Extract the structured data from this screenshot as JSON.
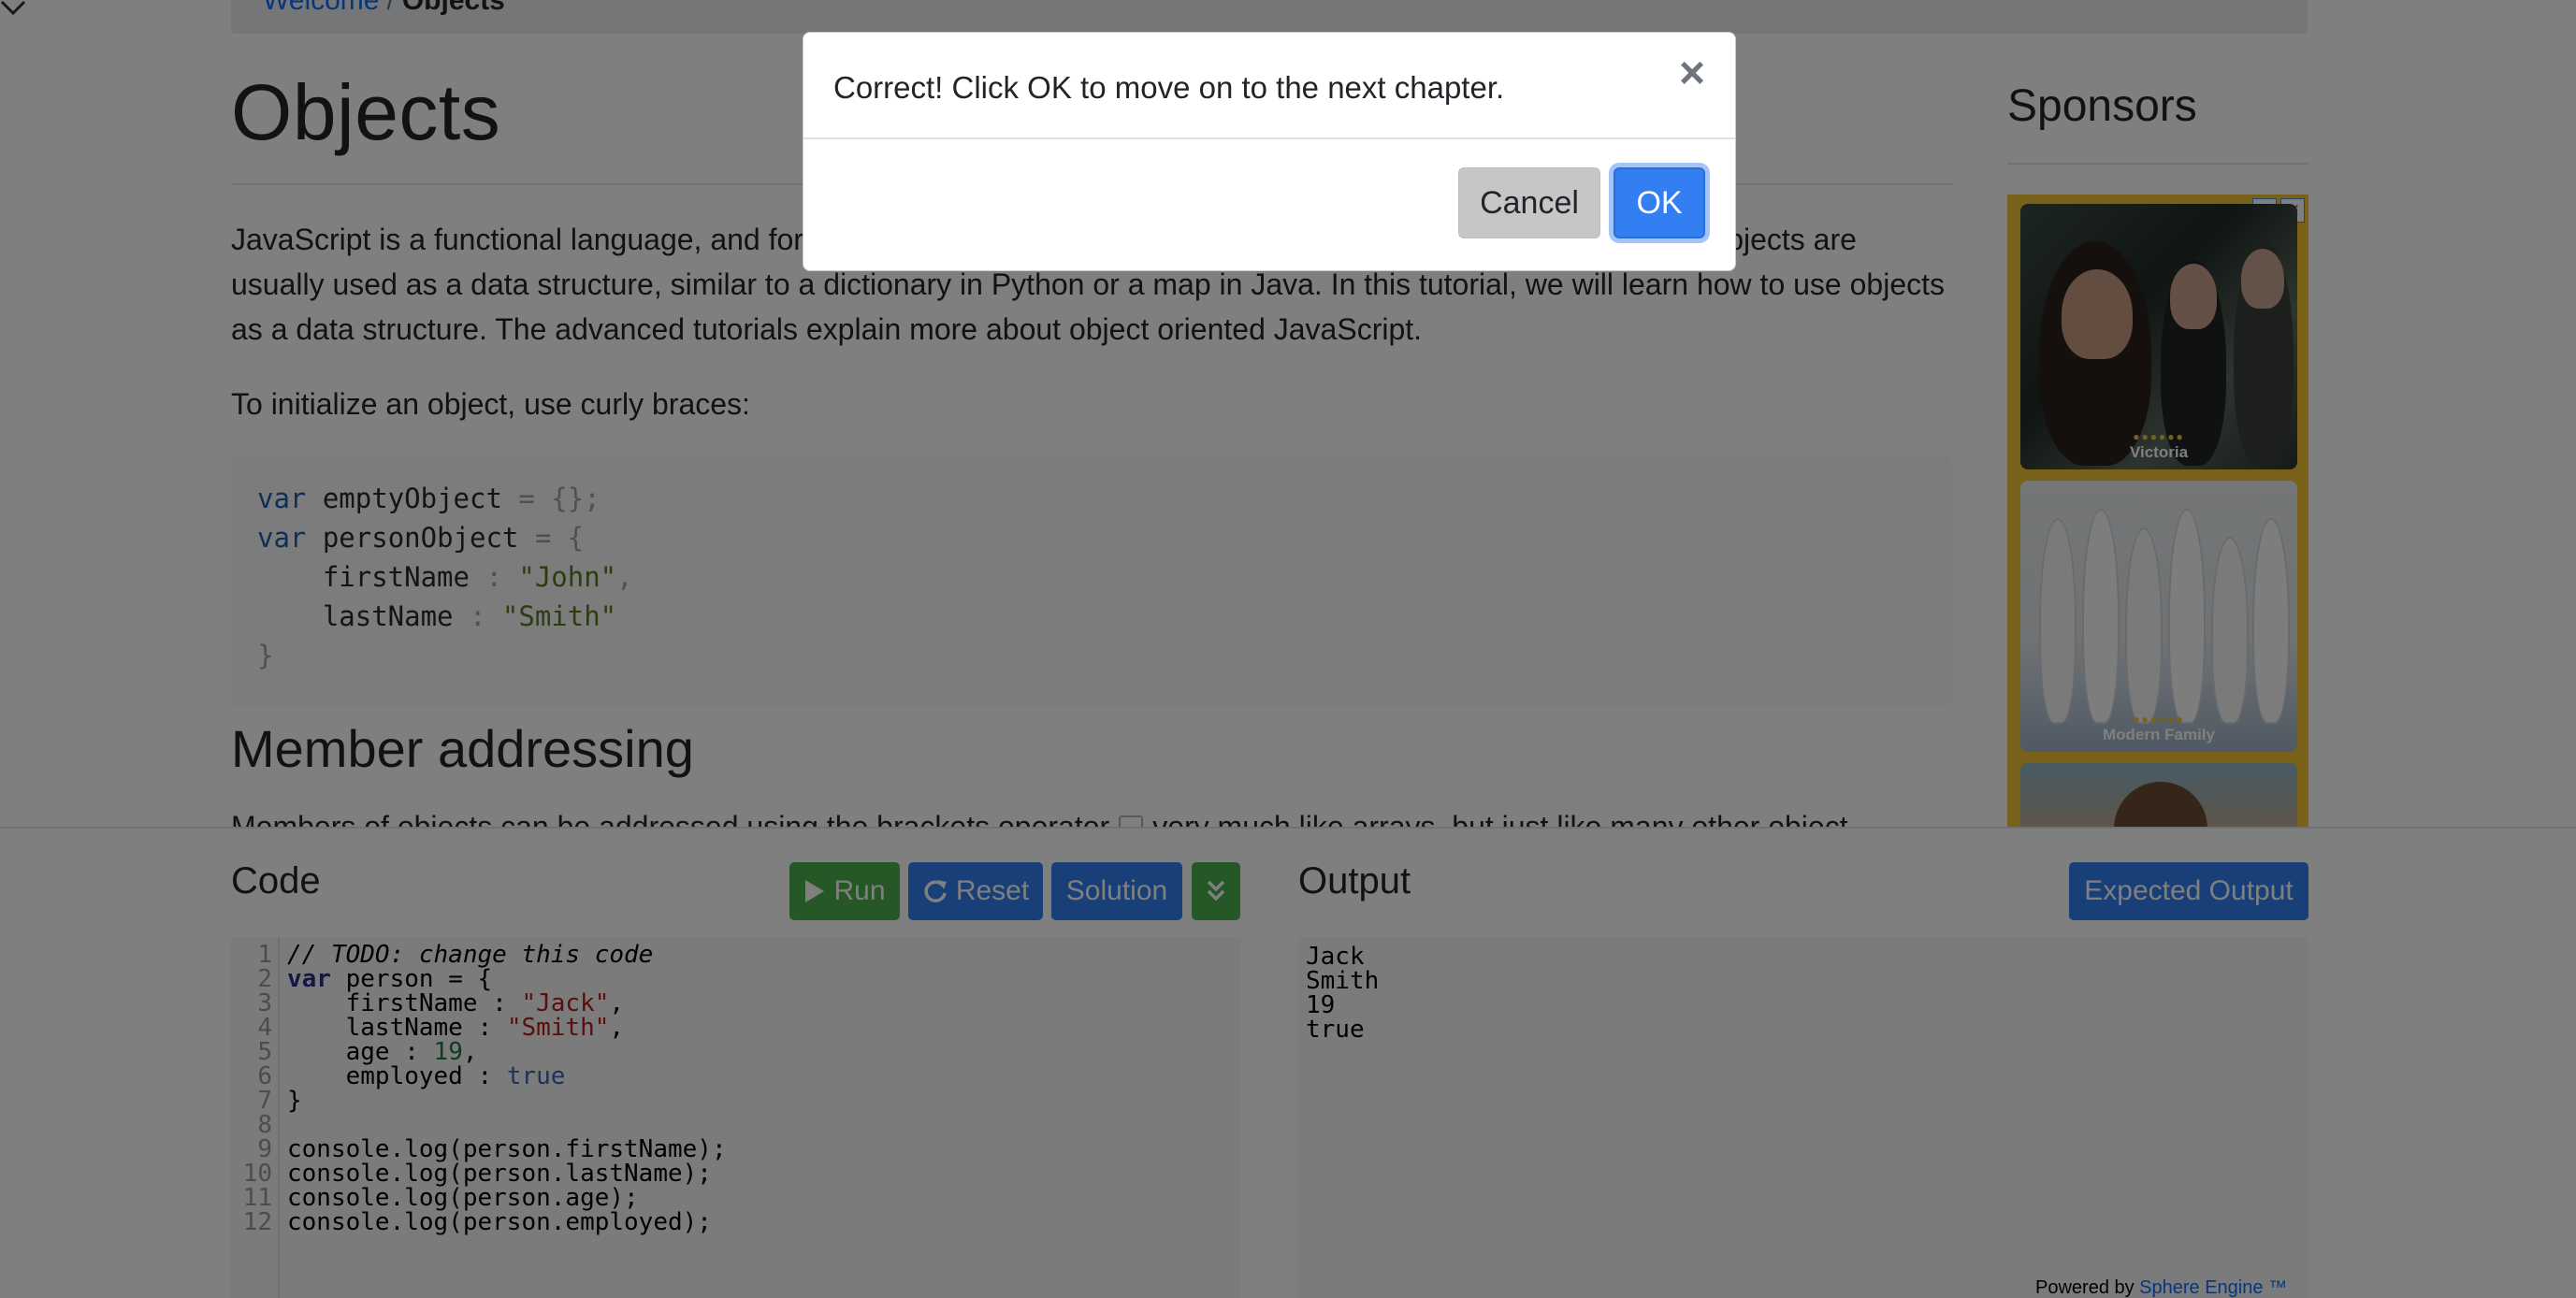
{
  "breadcrumb": {
    "home": "Welcome",
    "separator": "/",
    "current": "Objects"
  },
  "article": {
    "title": "Objects",
    "para1": "JavaScript is a functional language, and for object oriented programming it uses both objects and functions, but objects are usually used as a data structure, similar to a dictionary in Python or a map in Java. In this tutorial, we will learn how to use objects as a data structure. The advanced tutorials explain more about object oriented JavaScript.",
    "para2": "To initialize an object, use curly braces:",
    "code": {
      "l1_kw": "var",
      "l1_name": " emptyObject ",
      "l1_rest": "= {};",
      "l2_kw": "var",
      "l2_name": " personObject ",
      "l2_rest": "= {",
      "l3_key": "    firstName ",
      "l3_sep": ": ",
      "l3_val": "\"John\"",
      "l3_end": ",",
      "l4_key": "    lastName ",
      "l4_sep": ": ",
      "l4_val": "\"Smith\"",
      "l5": "}"
    },
    "section_heading": "Member addressing",
    "para3_a": "Members of objects can be addressed using the brackets operator",
    "para3_b": "very much like arrays, but just like many other object"
  },
  "sponsors": {
    "title": "Sponsors",
    "ad_cards": [
      {
        "label": "Victoria",
        "stars": "●●●●●●"
      },
      {
        "label": "Modern Family",
        "stars": "●●●●●●"
      }
    ],
    "ad_icons": [
      "▷",
      "✕"
    ]
  },
  "editor": {
    "code_heading": "Code",
    "output_heading": "Output",
    "buttons": {
      "run": "Run",
      "reset": "Reset",
      "solution": "Solution",
      "expected": "Expected Output"
    },
    "line_numbers": [
      "1",
      "2",
      "3",
      "4",
      "5",
      "6",
      "7",
      "8",
      "9",
      "10",
      "11",
      "12"
    ],
    "lines": {
      "l1": "// TODO: change this code",
      "l2_kw": "var",
      "l2_rest": " person = {",
      "l3_key": "    firstName : ",
      "l3_val": "\"Jack\"",
      "l3_end": ",",
      "l4_key": "    lastName : ",
      "l4_val": "\"Smith\"",
      "l4_end": ",",
      "l5_key": "    age : ",
      "l5_val": "19",
      "l5_end": ",",
      "l6_key": "    employed : ",
      "l6_val": "true",
      "l7": "}",
      "l8": "",
      "l9": "console.log(person.firstName);",
      "l10": "console.log(person.lastName);",
      "l11": "console.log(person.age);",
      "l12": "console.log(person.employed);"
    },
    "output": [
      "Jack",
      "Smith",
      "19",
      "true"
    ],
    "powered_by": "Powered by ",
    "powered_link": "Sphere Engine ™"
  },
  "modal": {
    "message": "Correct! Click OK to move on to the next chapter.",
    "close": "×",
    "cancel": "Cancel",
    "ok": "OK"
  }
}
